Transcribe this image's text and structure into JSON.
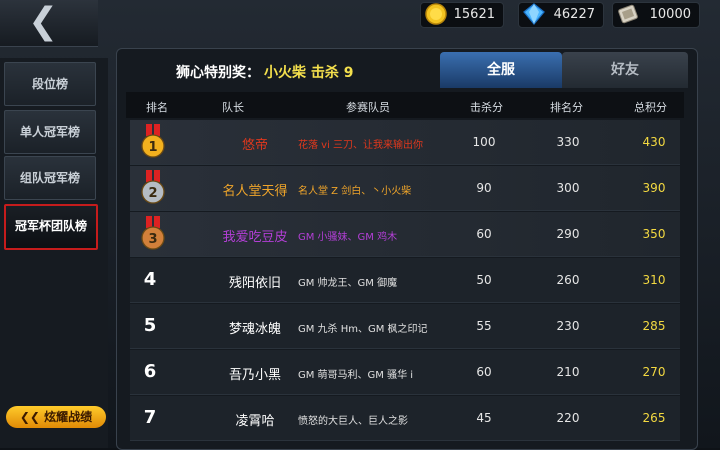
{
  "resources": [
    {
      "icon": "gold-coin-icon",
      "value": "15621"
    },
    {
      "icon": "diamond-icon",
      "value": "46227"
    },
    {
      "icon": "ticket-icon",
      "value": "10000"
    }
  ],
  "sidebar": {
    "items": [
      {
        "label": "段位榜"
      },
      {
        "label": "单人冠军榜"
      },
      {
        "label": "组队冠军榜"
      },
      {
        "label": "冠军杯团队榜"
      }
    ],
    "glory_button": "炫耀战绩"
  },
  "award": {
    "label": "狮心特别奖：",
    "value": "小火柴  击杀 9"
  },
  "tabs": [
    {
      "label": "全服"
    },
    {
      "label": "好友"
    }
  ],
  "headers": {
    "rank": "排名",
    "captain": "队长",
    "members": "参赛队员",
    "kill": "击杀分",
    "rank_score": "排名分",
    "total": "总积分"
  },
  "rows": [
    {
      "rank": "1",
      "captain": "悠帝",
      "members": "花落 vi 三刀、让我来输出你",
      "kill": "100",
      "rank_score": "330",
      "total": "430",
      "color": "#e0381d"
    },
    {
      "rank": "2",
      "captain": "名人堂天得",
      "members": "名人堂 Z 剑白、丶小火柴",
      "kill": "90",
      "rank_score": "300",
      "total": "390",
      "color": "#f0a52a"
    },
    {
      "rank": "3",
      "captain": "我爱吃豆皮",
      "members": "GM 小骚妹、GM 鸡木",
      "kill": "60",
      "rank_score": "290",
      "total": "350",
      "color": "#b33fd6"
    },
    {
      "rank": "4",
      "captain": "残阳依旧",
      "members": "GM 帅龙王、GM 御魔",
      "kill": "50",
      "rank_score": "260",
      "total": "310",
      "color": "#ffffff"
    },
    {
      "rank": "5",
      "captain": "梦魂冰魄",
      "members": "GM 九杀 Hm、GM 枫之印记",
      "kill": "55",
      "rank_score": "230",
      "total": "285",
      "color": "#ffffff"
    },
    {
      "rank": "6",
      "captain": "吾乃小黑",
      "members": "GM 萌哥马利、GM 骚华 i",
      "kill": "60",
      "rank_score": "210",
      "total": "270",
      "color": "#ffffff"
    },
    {
      "rank": "7",
      "captain": "凌霄哈",
      "members": "愤怒的大巨人、巨人之影",
      "kill": "45",
      "rank_score": "220",
      "total": "265",
      "color": "#ffffff"
    }
  ],
  "colors": {
    "gold_medal": "#f2b01e",
    "silver_medal": "#b5bcc4",
    "bronze_medal": "#d2803a"
  }
}
